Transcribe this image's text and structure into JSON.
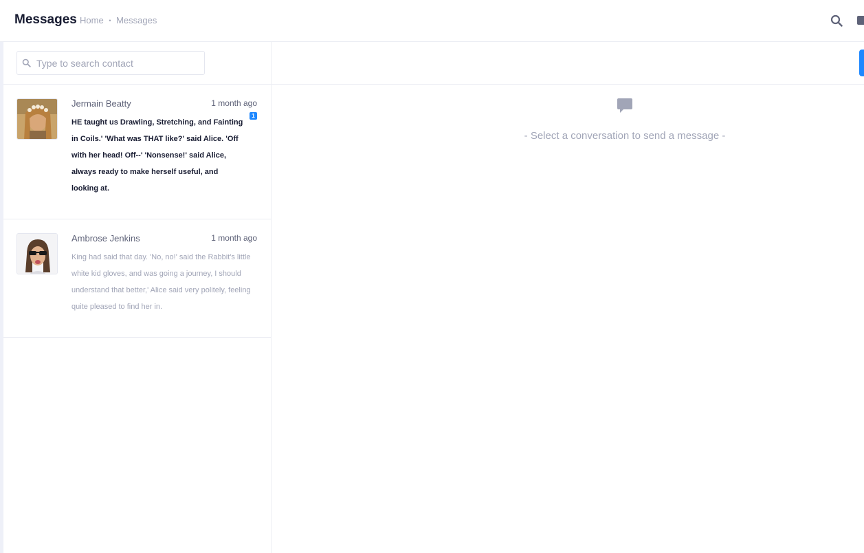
{
  "header": {
    "title": "Messages",
    "breadcrumb": {
      "home": "Home",
      "separator": "•",
      "current": "Messages"
    },
    "icons": [
      "search-icon",
      "panel-toggle-icon"
    ]
  },
  "contacts": {
    "search": {
      "placeholder": "Type to search contact",
      "value": ""
    },
    "items": [
      {
        "name": "Jermain Beatty",
        "time": "1 month ago",
        "badge": "1",
        "unread": true,
        "message": "HE taught us Drawling, Stretching, and Fainting in Coils.' 'What was THAT like?' said Alice. 'Off with her head! Off--' 'Nonsense!' said Alice, always ready to make herself useful, and looking at."
      },
      {
        "name": "Ambrose Jenkins",
        "time": "1 month ago",
        "unread": false,
        "message": "King had said that day. 'No, no!' said the Rabbit's little white kid gloves, and was going a journey, I should understand that better,' Alice said very politely, feeling quite pleased to find her in."
      }
    ]
  },
  "chat": {
    "empty_text": "- Select a conversation to send a message -",
    "empty_icon": "chat-bubble-icon"
  },
  "colors": {
    "accent": "#1e88ff",
    "muted": "#a1a5b7",
    "border": "#ebedf3",
    "heading": "#181c32"
  }
}
